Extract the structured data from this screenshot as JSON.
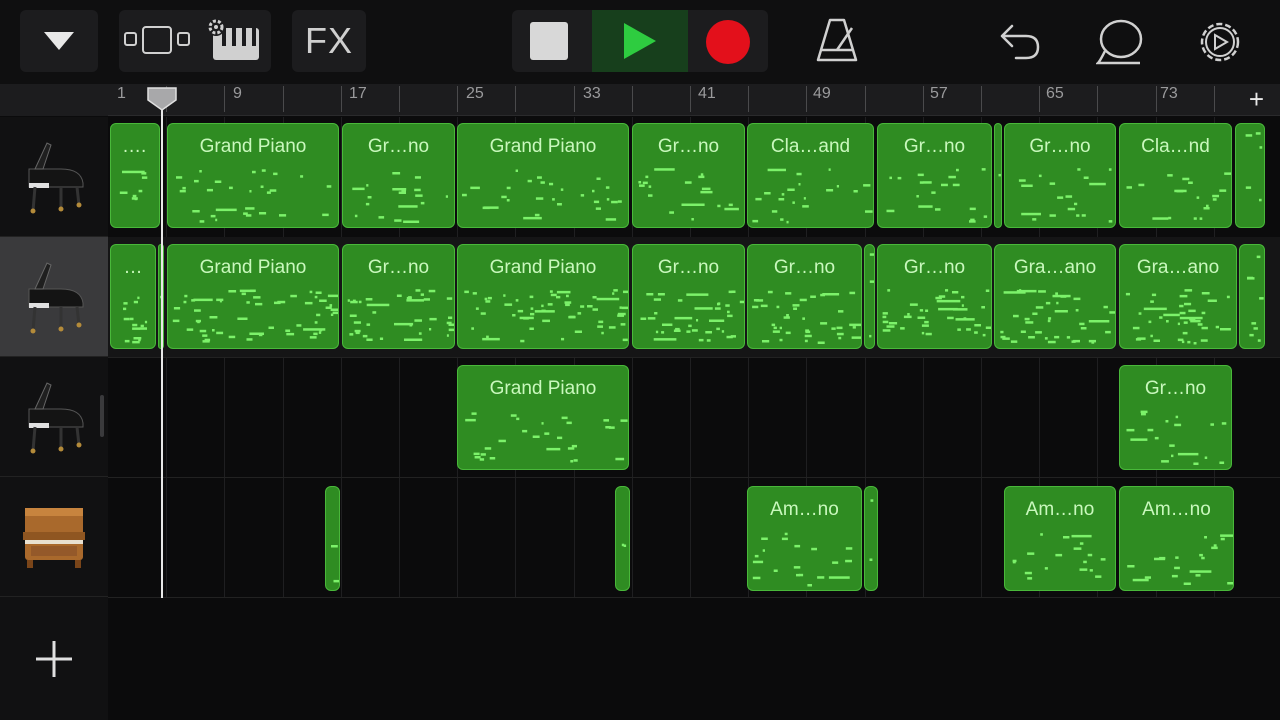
{
  "toolbar": {
    "tracks_menu_icon": "triangle-down-icon",
    "view_icon": "track-view-icon",
    "instrument_icon": "keyboard-settings-icon",
    "fx_label": "FX",
    "stop_icon": "stop-icon",
    "play_icon": "play-icon",
    "record_icon": "record-icon",
    "metronome_icon": "metronome-icon",
    "undo_icon": "undo-icon",
    "loop_browser_icon": "loop-icon",
    "settings_icon": "gear-icon"
  },
  "ruler": {
    "bars": [
      "1",
      "9",
      "17",
      "25",
      "33",
      "41",
      "49",
      "57",
      "65",
      "73"
    ],
    "add_label": "+"
  },
  "tracks": [
    {
      "instrument": "grand-piano-icon",
      "selected": false,
      "regions": [
        ".…",
        "Grand Piano",
        "Gr…no",
        "Grand Piano",
        "Gr…no",
        "Cla…and",
        "Gr…no",
        "Gr…no",
        "Cla…nd"
      ]
    },
    {
      "instrument": "grand-piano-icon",
      "selected": true,
      "regions": [
        "…",
        "Grand Piano",
        "Gr…no",
        "Grand Piano",
        "Gr…no",
        "Gr…no",
        "Gr…no",
        "Gra…ano",
        "Gra…ano"
      ]
    },
    {
      "instrument": "grand-piano-icon",
      "selected": false,
      "regions": [
        "Grand Piano",
        "Gr…no"
      ]
    },
    {
      "instrument": "upright-piano-icon",
      "selected": false,
      "regions": [
        "Am…no",
        "Am…no",
        "Am…no"
      ]
    }
  ],
  "add_track_label": "+",
  "colors": {
    "region": "#2f8c22",
    "region_border": "#49b83a",
    "region_text": "#c9f8bd",
    "notes": "#7cf26a",
    "play": "#2ecc40",
    "record": "#e3101b"
  }
}
